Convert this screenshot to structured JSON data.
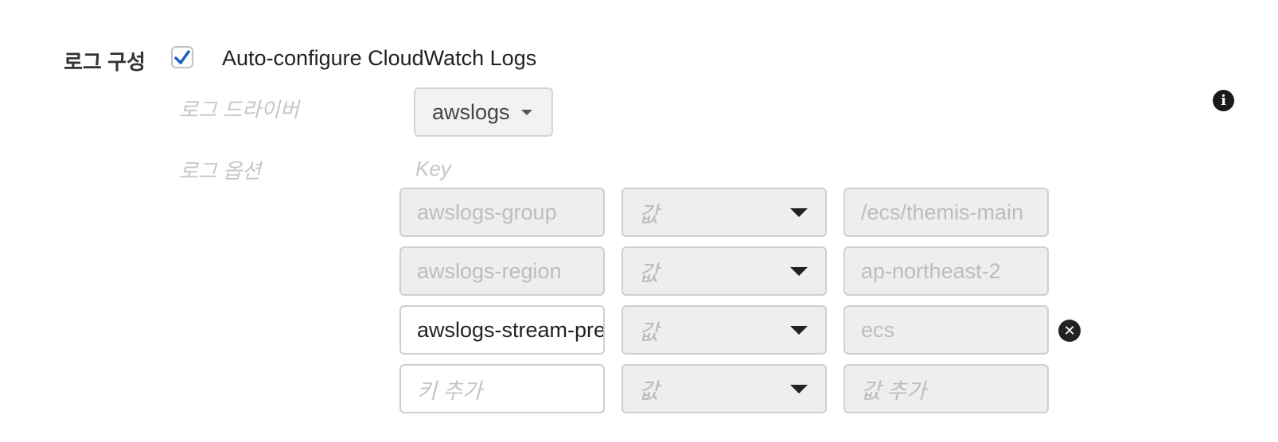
{
  "section": {
    "label": "로그 구성",
    "auto_configure": {
      "checked": true,
      "label": "Auto-configure CloudWatch Logs"
    }
  },
  "log_driver": {
    "label": "로그 드라이버",
    "value": "awslogs"
  },
  "log_options": {
    "label": "로그 옵션",
    "key_header": "Key",
    "rows": [
      {
        "key": "awslogs-group",
        "value_type": "값",
        "value": "/ecs/themis-main"
      },
      {
        "key": "awslogs-region",
        "value_type": "값",
        "value": "ap-northeast-2"
      },
      {
        "key": "awslogs-stream-prefix",
        "value_type": "값",
        "value": "ecs"
      }
    ],
    "new_row": {
      "key_placeholder": "키 추가",
      "value_type": "값",
      "value_placeholder": "값 추가"
    }
  },
  "icons": {
    "check": "check-icon",
    "caret": "caret-down-icon",
    "info": "info-icon",
    "remove": "remove-icon"
  }
}
